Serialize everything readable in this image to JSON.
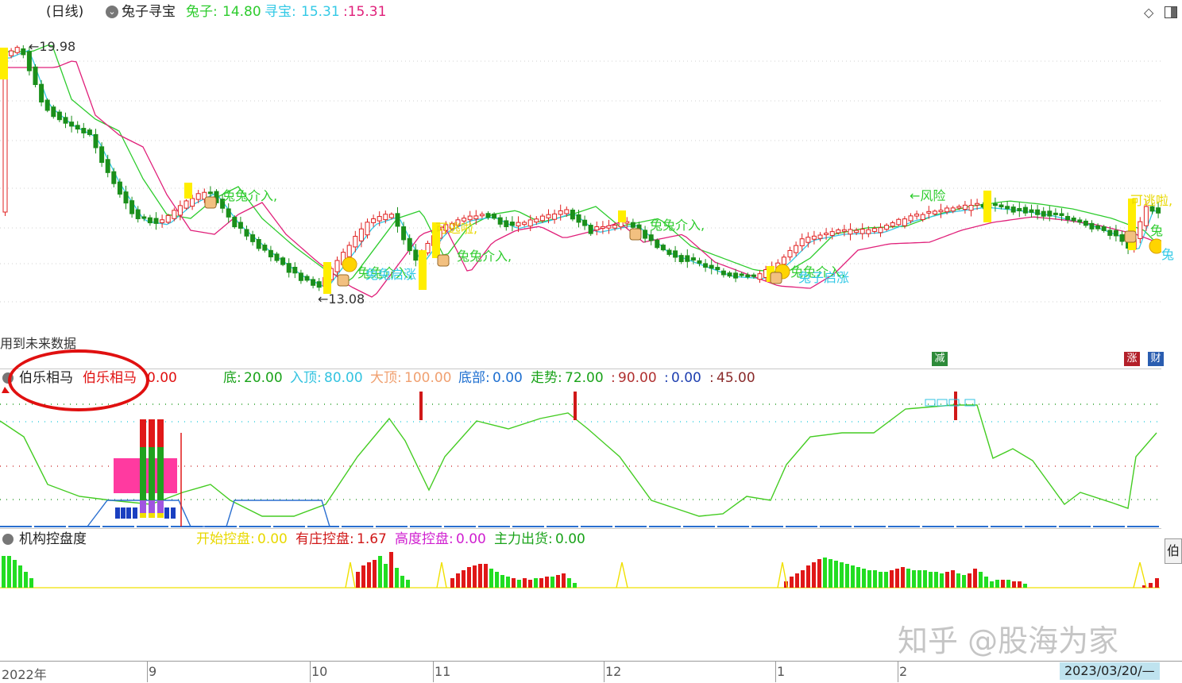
{
  "header": {
    "period": "(日线)",
    "indicator_name": "兔子寻宝",
    "rabbit_label": "兔子:",
    "rabbit_value": "14.80",
    "treasure_label": "寻宝:",
    "treasure_value": "15.31",
    "extra_value": ":15.31"
  },
  "price_chart": {
    "high_marker": "19.98",
    "low_marker": "13.08",
    "annotations": [
      "兔兔介入,",
      "兔兔介入,",
      "兔兔介入,",
      "兔兔介入,",
      "兔兔介入,",
      "兔子启涨",
      "兔兔启涨",
      "风险",
      "可逃啦,",
      "可逃啦,",
      "兔",
      "兔"
    ],
    "warning_text": "用到未来数据",
    "badges": [
      {
        "text": "减",
        "color": "#2e8b3a"
      },
      {
        "text": "涨",
        "color": "#b3202a"
      },
      {
        "text": "财",
        "color": "#2a5db0"
      }
    ]
  },
  "panel2": {
    "title": "伯乐相马",
    "title_red": "伯乐相马",
    "title_value": "0.00",
    "params": [
      {
        "label": "底:",
        "value": "20.00",
        "color": "#1aa31a"
      },
      {
        "label": "入顶:",
        "value": "80.00",
        "color": "#33c3e0"
      },
      {
        "label": "大顶:",
        "value": "100.00",
        "color": "#f0a070"
      },
      {
        "label": "底部:",
        "value": "0.00",
        "color": "#1e6fd0"
      },
      {
        "label": "走势:",
        "value": "72.00",
        "color": "#1aa31a"
      },
      {
        "label": ":",
        "value": "90.00",
        "color": "#b03030"
      },
      {
        "label": ":",
        "value": "0.00",
        "color": "#1e3fb0"
      },
      {
        "label": ":",
        "value": "45.00",
        "color": "#8a2a2a"
      }
    ]
  },
  "panel3": {
    "title": "机构控盘度",
    "params": [
      {
        "label": "开始控盘:",
        "value": "0.00",
        "color": "#e8d800"
      },
      {
        "label": "有庄控盘:",
        "value": "1.67",
        "color": "#d01818"
      },
      {
        "label": "高度控盘:",
        "value": "0.00",
        "color": "#d020d0"
      },
      {
        "label": "主力出货:",
        "value": "0.00",
        "color": "#1aa31a"
      }
    ],
    "side_button": "伯"
  },
  "xaxis": {
    "labels": [
      "2022年",
      "9",
      "10",
      "11",
      "12",
      "1",
      "2"
    ],
    "current_date": "2023/03/20/—"
  },
  "watermark": "知乎 @股海为家",
  "colors": {
    "up": "#e02020",
    "down": "#1a8f1a",
    "ma_fast": "#33c9e6",
    "ma_mid": "#e0207a",
    "ma_slow": "#2ecc2e",
    "signal_yellow": "#ffee00",
    "annotation_red_circle": "#e01010"
  }
}
